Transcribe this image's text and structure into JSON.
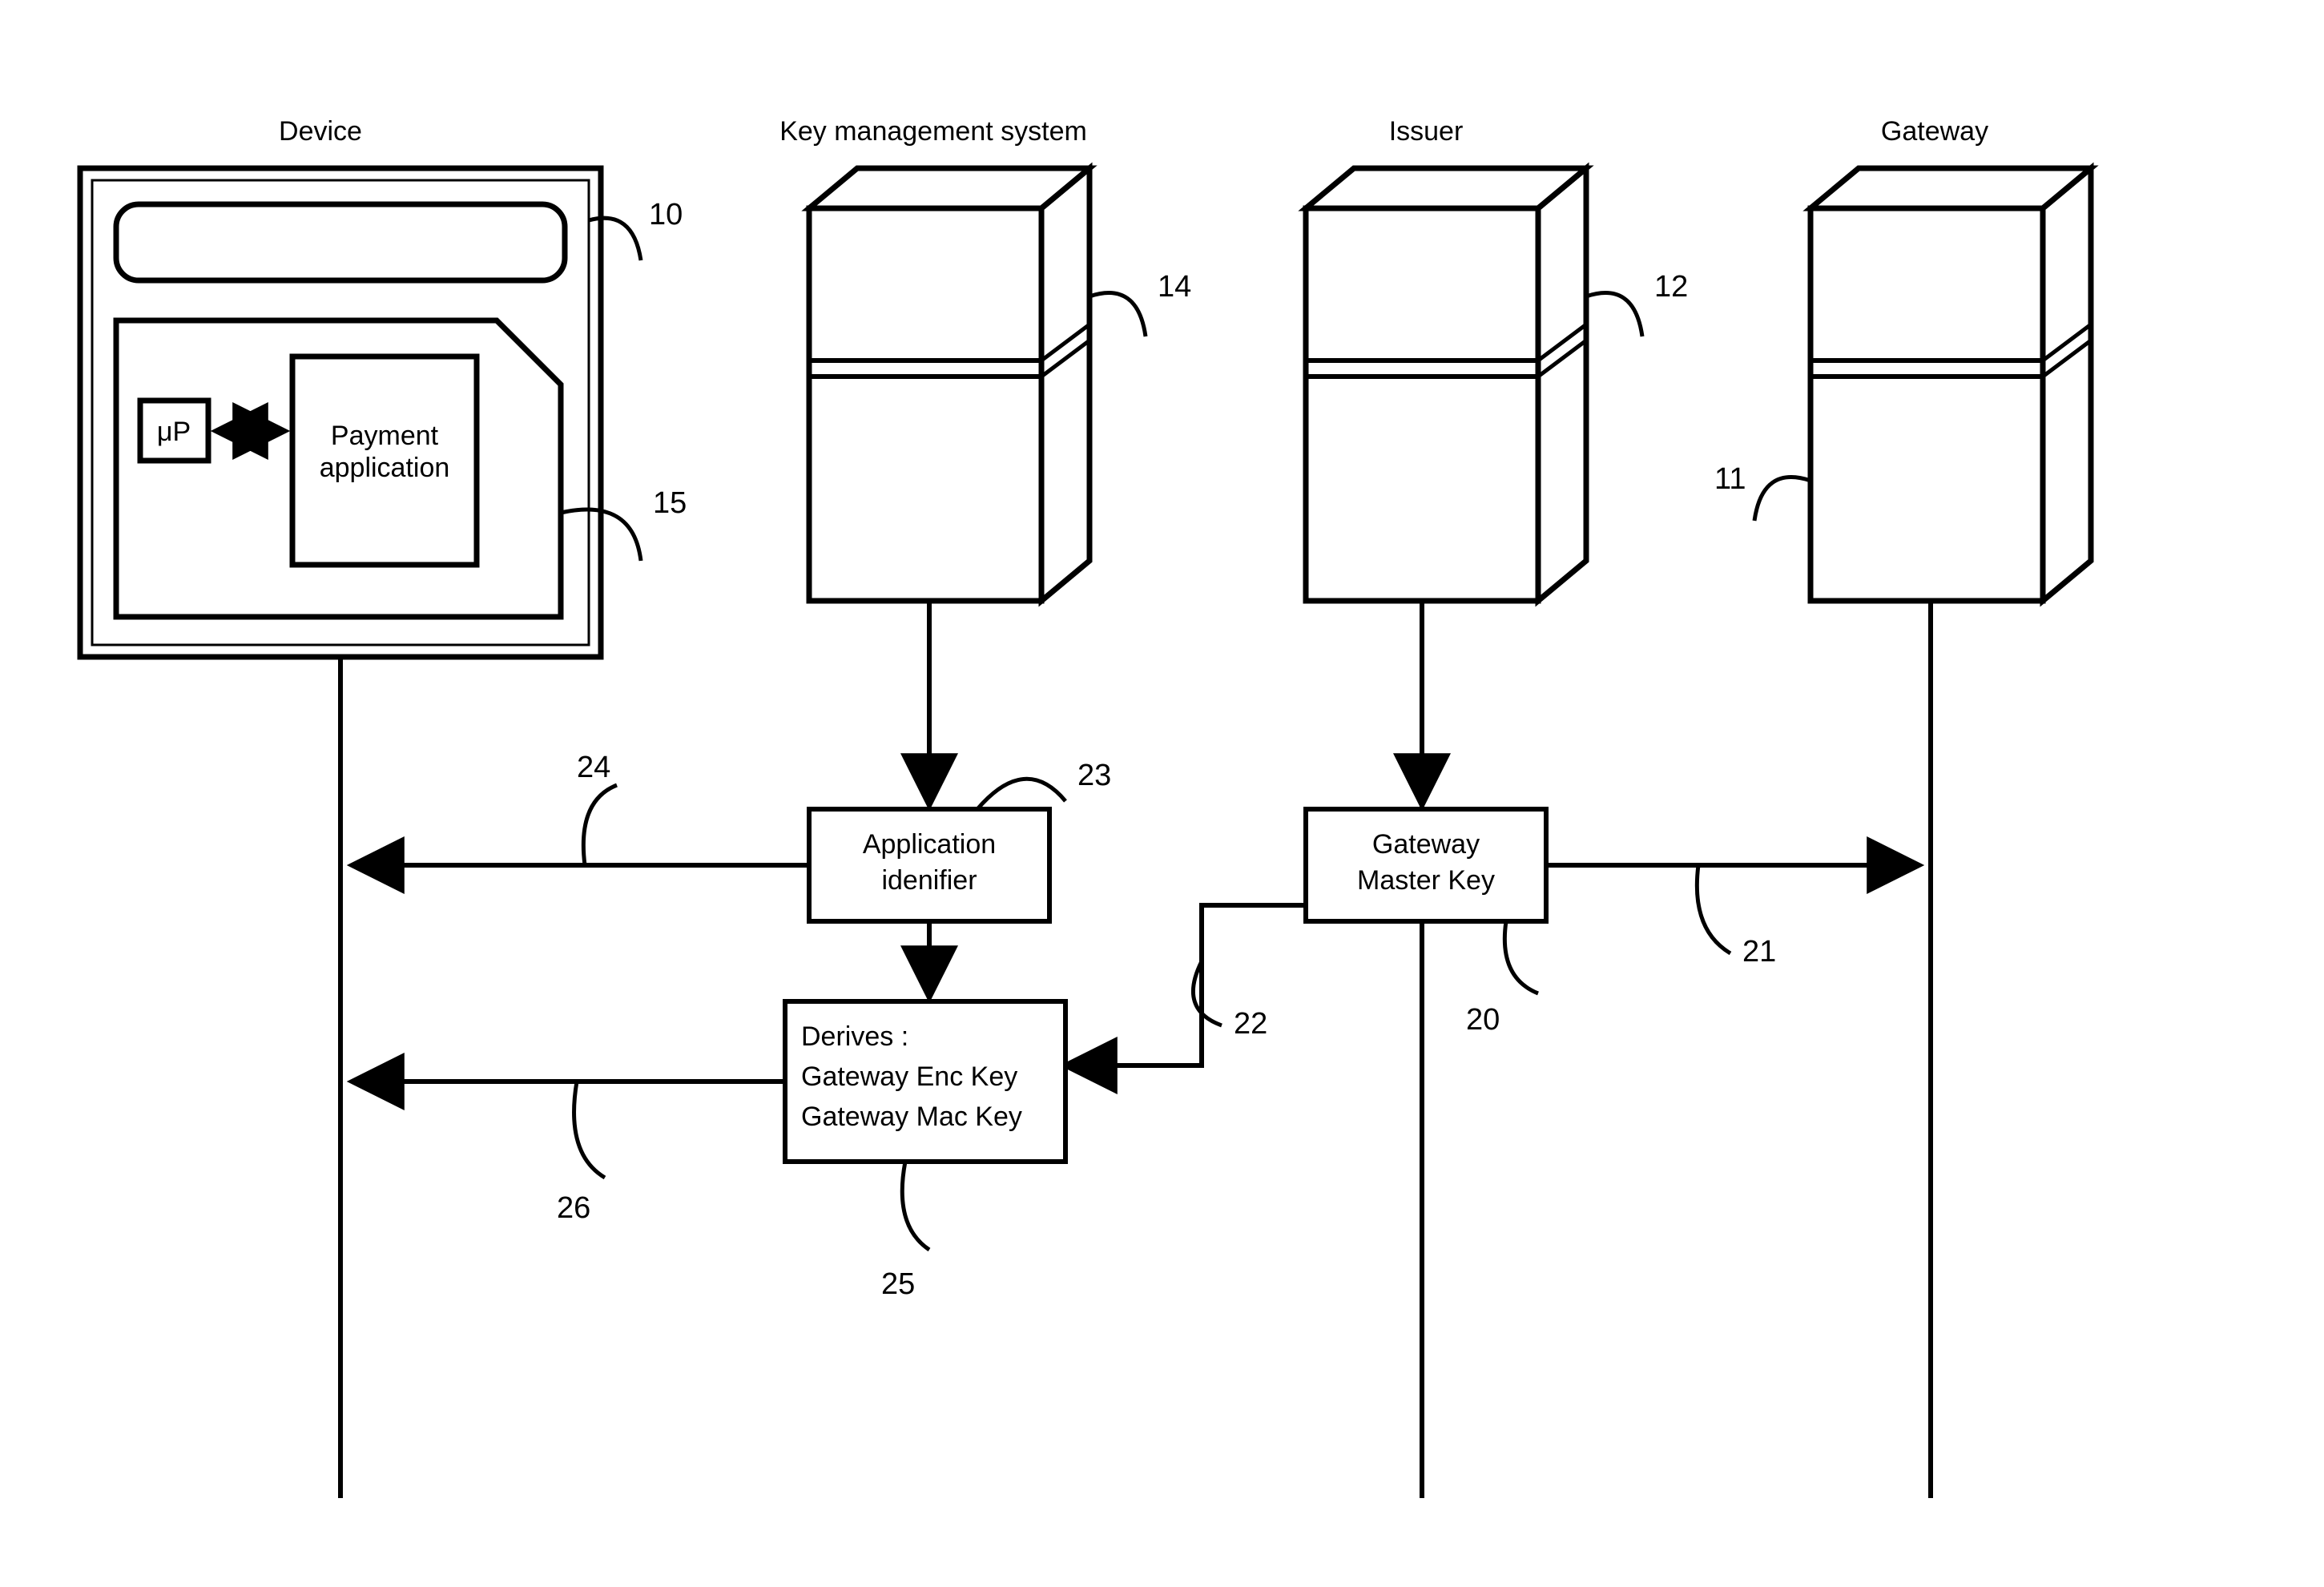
{
  "titles": {
    "device": "Device",
    "kms": "Key management system",
    "issuer": "Issuer",
    "gateway": "Gateway"
  },
  "device": {
    "micro_p": "μP",
    "payment_app_l1": "Payment",
    "payment_app_l2": "application"
  },
  "box_app_id": {
    "l1": "Application",
    "l2": "idenifier"
  },
  "box_gmk": {
    "l1": "Gateway",
    "l2": "Master Key"
  },
  "box_derives": {
    "l1": "Derives :",
    "l2": "Gateway Enc Key",
    "l3": "Gateway Mac Key"
  },
  "refs": {
    "r10": "10",
    "r11": "11",
    "r12": "12",
    "r14": "14",
    "r15": "15",
    "r20": "20",
    "r21": "21",
    "r22": "22",
    "r23": "23",
    "r24": "24",
    "r25": "25",
    "r26": "26"
  }
}
